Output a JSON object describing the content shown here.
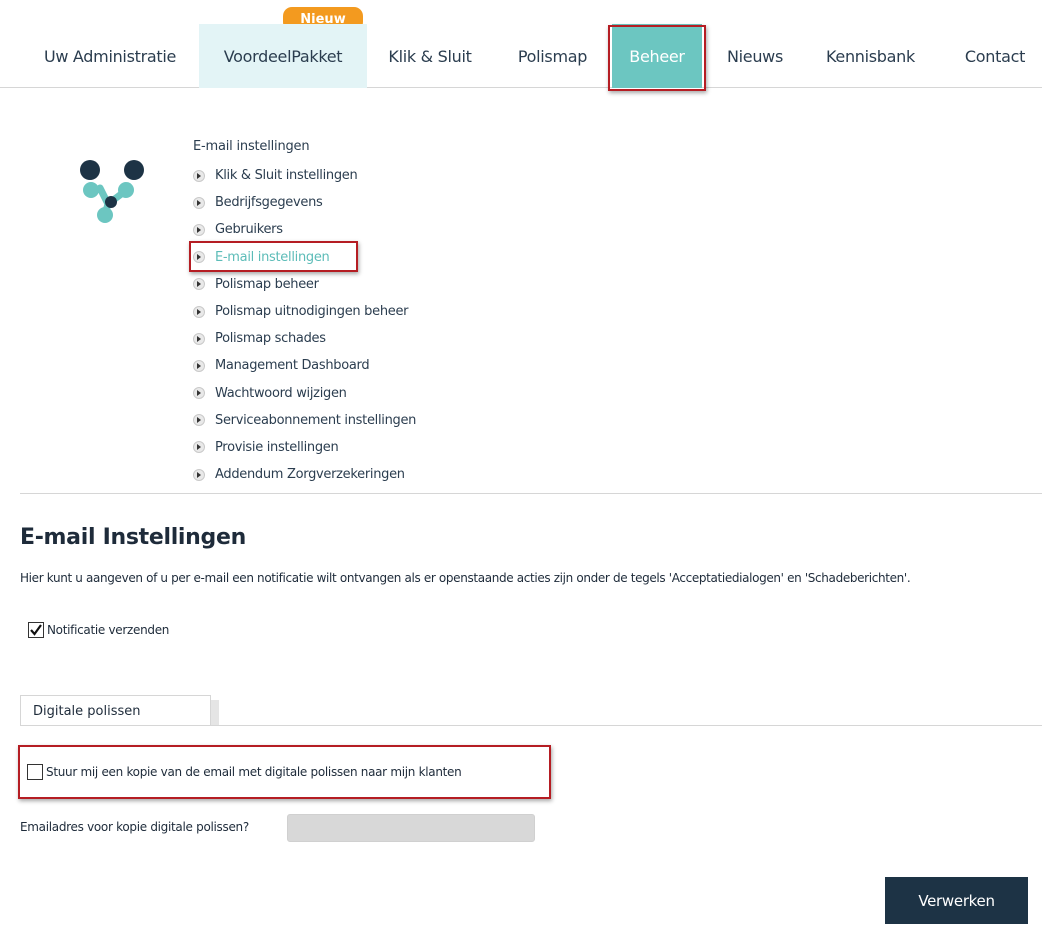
{
  "nav": {
    "badge": "Nieuw",
    "items": [
      {
        "label": "Uw Administratie"
      },
      {
        "label": "VoordeelPakket"
      },
      {
        "label": "Klik & Sluit"
      },
      {
        "label": "Polismap"
      },
      {
        "label": "Beheer"
      },
      {
        "label": "Nieuws"
      },
      {
        "label": "Kennisbank"
      },
      {
        "label": "Contact"
      }
    ],
    "active_index": 4
  },
  "submenu": {
    "title": "E-mail instellingen",
    "items": [
      {
        "label": "Klik & Sluit instellingen"
      },
      {
        "label": "Bedrijfsgegevens"
      },
      {
        "label": "Gebruikers"
      },
      {
        "label": "E-mail instellingen"
      },
      {
        "label": "Polismap beheer"
      },
      {
        "label": "Polismap uitnodigingen beheer"
      },
      {
        "label": "Polismap schades"
      },
      {
        "label": "Management Dashboard"
      },
      {
        "label": "Wachtwoord wijzigen"
      },
      {
        "label": "Serviceabonnement instellingen"
      },
      {
        "label": "Provisie instellingen"
      },
      {
        "label": "Addendum Zorgverzekeringen"
      }
    ],
    "current_index": 3
  },
  "main": {
    "title": "E-mail Instellingen",
    "intro": "Hier kunt u aangeven of u per e-mail een notificatie wilt ontvangen als er openstaande acties zijn onder de tegels 'Acceptatiedialogen' en 'Schadeberichten'.",
    "notify": {
      "label": "Notificatie verzenden",
      "checked": true
    },
    "tab_label": "Digitale polissen",
    "copy_option": {
      "label": "Stuur mij een kopie van de email met digitale polissen naar mijn klanten",
      "checked": false
    },
    "email_copy": {
      "label": "Emailadres voor kopie digitale polissen?",
      "value": ""
    },
    "submit_label": "Verwerken"
  },
  "colors": {
    "accent": "#6cc6c1",
    "nav_highlight_bg": "#e3f4f6",
    "badge": "#f39a1f",
    "annotation_red": "#b51d23",
    "button_dark": "#1d3345",
    "logo_dark": "#1d3345",
    "logo_teal": "#6cc6c1"
  }
}
